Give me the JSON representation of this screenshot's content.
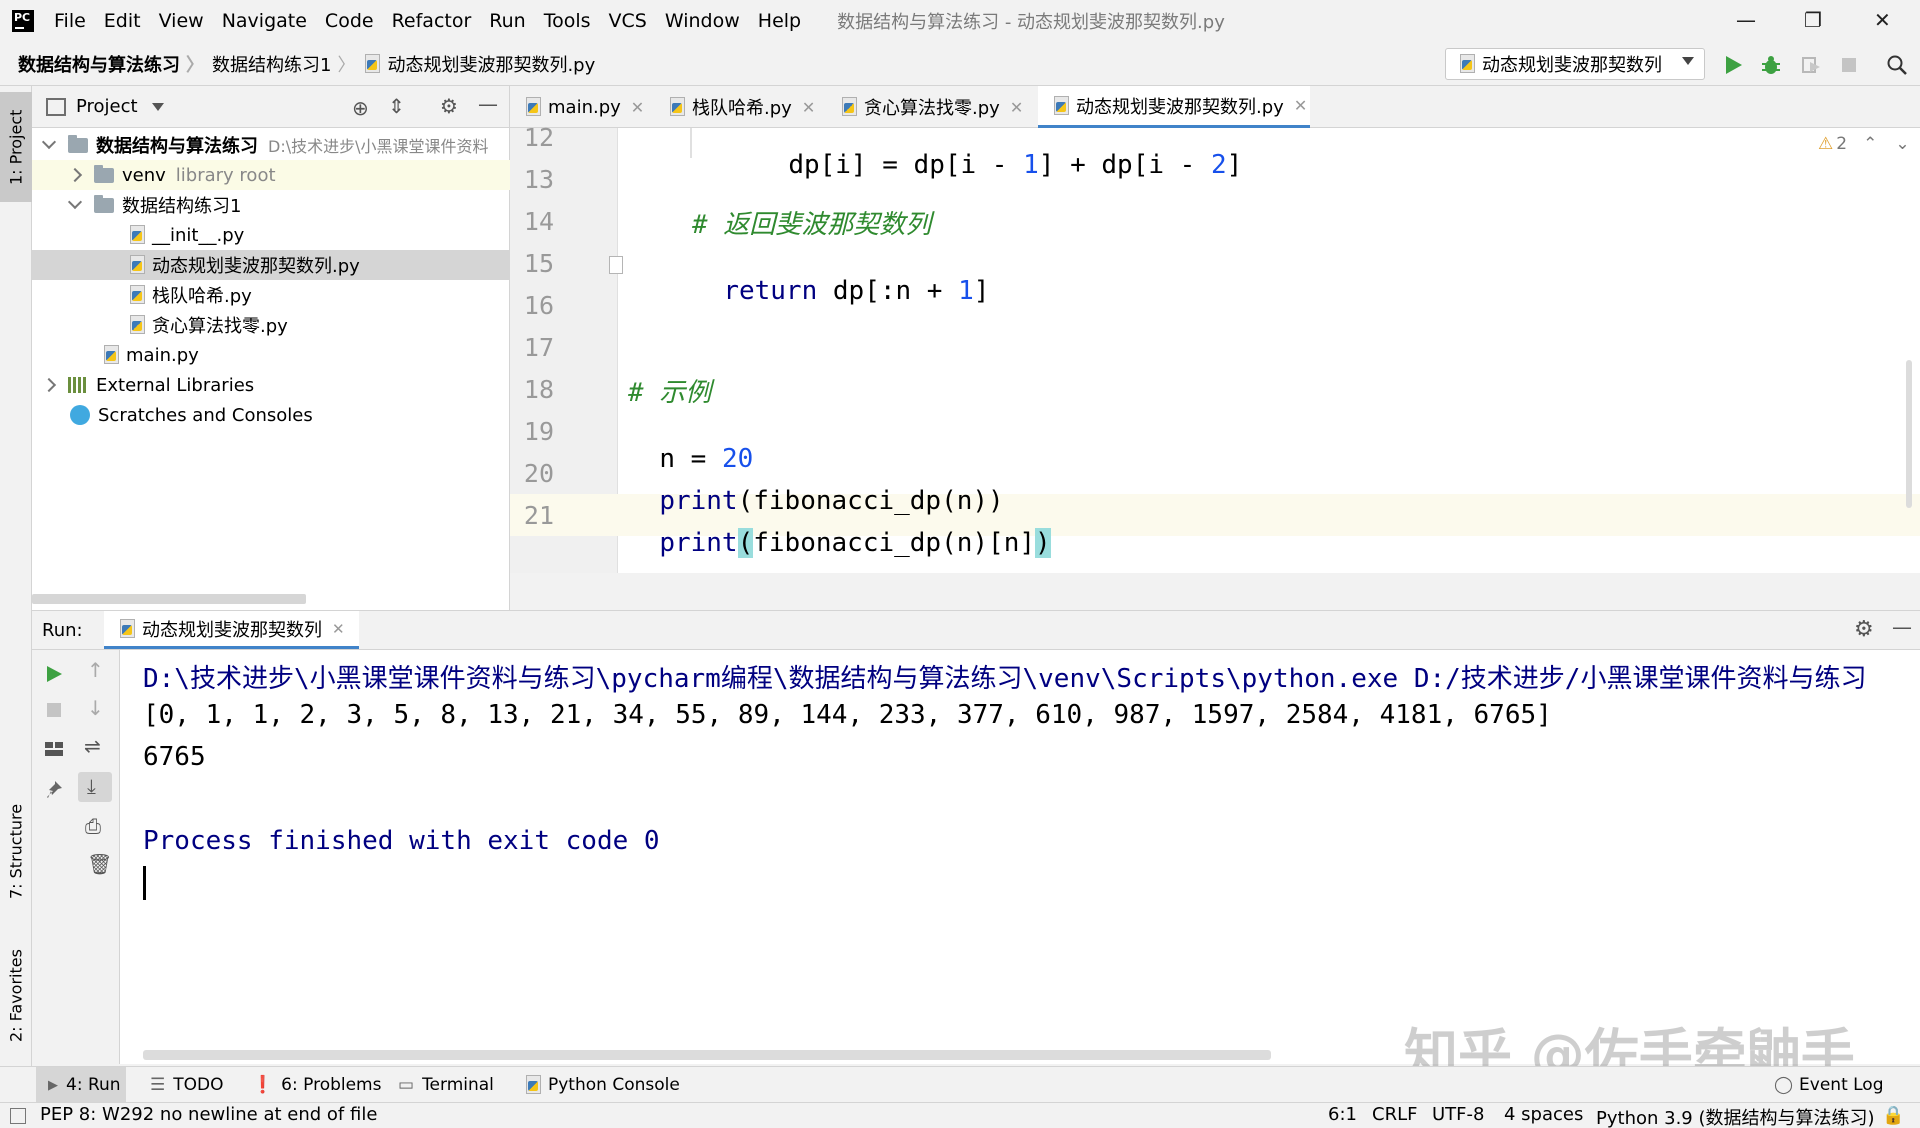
{
  "menu": {
    "items": [
      "File",
      "Edit",
      "View",
      "Navigate",
      "Code",
      "Refactor",
      "Run",
      "Tools",
      "VCS",
      "Window",
      "Help"
    ],
    "window_title": "数据结构与算法练习 - 动态规划斐波那契数列.py"
  },
  "breadcrumb": {
    "project": "数据结构与算法练习",
    "folder": "数据结构练习1",
    "file": "动态规划斐波那契数列.py"
  },
  "run_config": {
    "label": "动态规划斐波那契数列"
  },
  "left_strip": {
    "project": "1: Project",
    "structure": "7: Structure",
    "favorites": "2: Favorites"
  },
  "project_panel": {
    "title": "Project",
    "root_name": "数据结构与算法练习",
    "root_path": "D:\\技术进步\\小黑课堂课件资料",
    "venv_name": "venv",
    "venv_note": "library root",
    "folder": "数据结构练习1",
    "files": [
      "__init__.py",
      "动态规划斐波那契数列.py",
      "栈队哈希.py",
      "贪心算法找零.py"
    ],
    "main": "main.py",
    "external": "External Libraries",
    "scratches": "Scratches and Consoles"
  },
  "editor": {
    "tabs": [
      "main.py",
      "栈队哈希.py",
      "贪心算法找零.py",
      "动态规划斐波那契数列.py"
    ],
    "warnings": "2",
    "line_numbers": [
      "12",
      "13",
      "14",
      "15",
      "16",
      "17",
      "18",
      "19",
      "20",
      "21"
    ],
    "code": {
      "l12a": "dp[i] = dp[i - ",
      "l12n1": "1",
      "l12b": "] + dp[i - ",
      "l12n2": "2",
      "l12c": "]",
      "l14": "# 返回斐波那契数列",
      "l15kw": "return",
      "l15a": " dp[:n + ",
      "l15n": "1",
      "l15b": "]",
      "l18": "# 示例",
      "l19a": "n = ",
      "l19n": "20",
      "l20kw": "print",
      "l20a": "(fibonacci_dp(n))",
      "l21kw": "print",
      "l21p1": "(",
      "l21a": "fibonacci_dp(n)[n]",
      "l21p2": ")"
    }
  },
  "run": {
    "label": "Run:",
    "tab": "动态规划斐波那契数列",
    "output": [
      "D:\\技术进步\\小黑课堂课件资料与练习\\pycharm编程\\数据结构与算法练习\\venv\\Scripts\\python.exe D:/技术进步/小黑课堂课件资料与练习",
      "[0, 1, 1, 2, 3, 5, 8, 13, 21, 34, 55, 89, 144, 233, 377, 610, 987, 1597, 2584, 4181, 6765]",
      "6765",
      "Process finished with exit code 0"
    ]
  },
  "bottom_tabs": {
    "run": "4: Run",
    "todo": "TODO",
    "problems": "6: Problems",
    "terminal": "Terminal",
    "python_console": "Python Console",
    "event_log": "Event Log"
  },
  "status": {
    "message": "PEP 8: W292 no newline at end of file",
    "position": "6:1",
    "line_sep": "CRLF",
    "encoding": "UTF-8",
    "indent": "4 spaces",
    "interpreter": "Python 3.9 (数据结构与算法练习)"
  },
  "watermark": "知乎 @佐手牵鼬手"
}
